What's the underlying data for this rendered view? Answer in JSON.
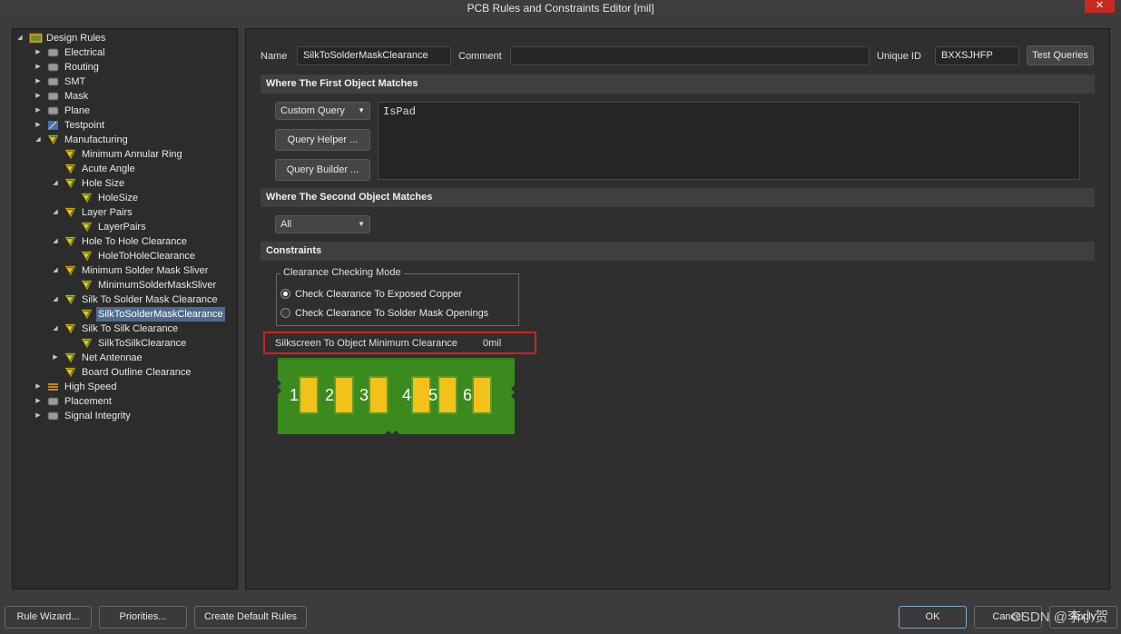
{
  "window": {
    "title": "PCB Rules and Constraints Editor [mil]",
    "close_glyph": "✕"
  },
  "tree": {
    "items": [
      {
        "label": "Design Rules",
        "level": 0,
        "expanded": true,
        "icon": "design-rules-icon"
      },
      {
        "label": "Electrical",
        "level": 1,
        "expanded": false,
        "icon": "electrical-icon"
      },
      {
        "label": "Routing",
        "level": 1,
        "expanded": false,
        "icon": "routing-icon"
      },
      {
        "label": "SMT",
        "level": 1,
        "expanded": false,
        "icon": "smt-icon"
      },
      {
        "label": "Mask",
        "level": 1,
        "expanded": false,
        "icon": "mask-icon"
      },
      {
        "label": "Plane",
        "level": 1,
        "expanded": false,
        "icon": "plane-icon"
      },
      {
        "label": "Testpoint",
        "level": 1,
        "expanded": false,
        "icon": "testpoint-icon"
      },
      {
        "label": "Manufacturing",
        "level": 1,
        "expanded": true,
        "icon": "rule-icon"
      },
      {
        "label": "Minimum Annular Ring",
        "level": 2,
        "icon": "rule-icon"
      },
      {
        "label": "Acute Angle",
        "level": 2,
        "icon": "rule-icon"
      },
      {
        "label": "Hole Size",
        "level": 2,
        "expanded": true,
        "icon": "rule-icon"
      },
      {
        "label": "HoleSize",
        "level": 3,
        "icon": "rule-icon"
      },
      {
        "label": "Layer Pairs",
        "level": 2,
        "expanded": true,
        "icon": "rule-icon"
      },
      {
        "label": "LayerPairs",
        "level": 3,
        "icon": "rule-icon"
      },
      {
        "label": "Hole To Hole Clearance",
        "level": 2,
        "expanded": true,
        "icon": "rule-icon"
      },
      {
        "label": "HoleToHoleClearance",
        "level": 3,
        "icon": "rule-icon"
      },
      {
        "label": "Minimum Solder Mask Sliver",
        "level": 2,
        "expanded": true,
        "icon": "rule-icon"
      },
      {
        "label": "MinimumSolderMaskSliver",
        "level": 3,
        "icon": "rule-icon"
      },
      {
        "label": "Silk To Solder Mask Clearance",
        "level": 2,
        "expanded": true,
        "icon": "rule-icon"
      },
      {
        "label": "SilkToSolderMaskClearance",
        "level": 3,
        "icon": "rule-icon",
        "selected": true
      },
      {
        "label": "Silk To Silk Clearance",
        "level": 2,
        "expanded": true,
        "icon": "rule-icon"
      },
      {
        "label": "SilkToSilkClearance",
        "level": 3,
        "icon": "rule-icon"
      },
      {
        "label": "Net Antennae",
        "level": 2,
        "expanded": false,
        "icon": "rule-icon"
      },
      {
        "label": "Board Outline Clearance",
        "level": 2,
        "icon": "rule-icon"
      },
      {
        "label": "High Speed",
        "level": 1,
        "expanded": false,
        "icon": "high-speed-icon"
      },
      {
        "label": "Placement",
        "level": 1,
        "expanded": false,
        "icon": "placement-icon"
      },
      {
        "label": "Signal Integrity",
        "level": 1,
        "expanded": false,
        "icon": "signal-integrity-icon"
      }
    ]
  },
  "rule": {
    "name_label": "Name",
    "name_value": "SilkToSolderMaskClearance",
    "comment_label": "Comment",
    "comment_value": "",
    "unique_id_label": "Unique ID",
    "unique_id_value": "BXXSJHFP",
    "test_queries_label": "Test Queries"
  },
  "first_match": {
    "header": "Where The First Object Matches",
    "query_type": "Custom Query",
    "query_helper_label": "Query Helper ...",
    "query_builder_label": "Query Builder ...",
    "query_text": "IsPad"
  },
  "second_match": {
    "header": "Where The Second Object Matches",
    "query_type": "All"
  },
  "constraints": {
    "header": "Constraints",
    "mode_group_title": "Clearance Checking Mode",
    "mode_options": [
      {
        "label": "Check Clearance To Exposed Copper",
        "checked": true
      },
      {
        "label": "Check Clearance To Solder Mask Openings",
        "checked": false
      }
    ],
    "min_clearance_label": "Silkscreen To Object Minimum Clearance",
    "min_clearance_value": "0mil",
    "preview_pads": [
      "1",
      "2",
      "3",
      "4",
      "5",
      "6"
    ]
  },
  "footer": {
    "rule_wizard_label": "Rule Wizard...",
    "priorities_label": "Priorities...",
    "create_default_label": "Create Default Rules",
    "ok_label": "OK",
    "cancel_label": "Cancel",
    "apply_label": "Apply",
    "watermark": "CSDN @李小贺"
  },
  "colors": {
    "pcb_green": "#3a8a1e",
    "pad_yellow": "#f2c21a",
    "highlight_red": "#d32020",
    "selection_blue": "#4e6a8c"
  }
}
